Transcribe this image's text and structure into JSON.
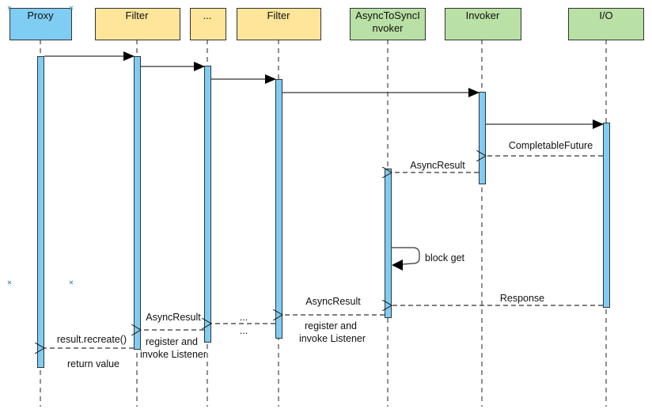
{
  "diagram": {
    "type": "sequence",
    "colors": {
      "proxy_fill": "#7fcdf3",
      "filter_fill": "#ffe599",
      "invoker_fill": "#b9e0a5",
      "activation_fill": "#7fcdf3",
      "stroke": "#333333",
      "lifeline": "#555555",
      "handle": "#4a90c8"
    },
    "participants": [
      {
        "id": "proxy",
        "label": "Proxy",
        "style": "proxy"
      },
      {
        "id": "filter1",
        "label": "Filter",
        "style": "filter"
      },
      {
        "id": "dots",
        "label": "...",
        "style": "filter"
      },
      {
        "id": "filter2",
        "label": "Filter",
        "style": "filter"
      },
      {
        "id": "async",
        "label_lines": [
          "AsyncToSyncI",
          "nvoker"
        ],
        "style": "invoker"
      },
      {
        "id": "invoker",
        "label": "Invoker",
        "style": "invoker"
      },
      {
        "id": "io",
        "label": "I/O",
        "style": "invoker"
      }
    ],
    "messages": [
      {
        "from": "proxy",
        "to": "filter1",
        "kind": "sync",
        "label": ""
      },
      {
        "from": "filter1",
        "to": "dots",
        "kind": "sync",
        "label": ""
      },
      {
        "from": "dots",
        "to": "filter2",
        "kind": "sync",
        "label": ""
      },
      {
        "from": "filter2",
        "to": "invoker",
        "kind": "sync",
        "label": ""
      },
      {
        "from": "invoker",
        "to": "io",
        "kind": "sync",
        "label": ""
      },
      {
        "from": "io",
        "to": "invoker",
        "kind": "return",
        "label": "CompletableFuture"
      },
      {
        "from": "invoker",
        "to": "async",
        "kind": "return",
        "label": "AsyncResult"
      },
      {
        "from": "async",
        "to": "async",
        "kind": "self",
        "label": "block get"
      },
      {
        "from": "io",
        "to": "async",
        "kind": "return",
        "label": "Response"
      },
      {
        "from": "async",
        "to": "filter2",
        "kind": "return",
        "label": "AsyncResult",
        "note_lines": [
          "register and",
          "invoke Listener"
        ]
      },
      {
        "from": "filter2",
        "to": "dots",
        "kind": "return",
        "label": "...",
        "note": "..."
      },
      {
        "from": "dots",
        "to": "filter1",
        "kind": "return",
        "label": "AsyncResult",
        "note_lines": [
          "register and",
          "invoke Listener"
        ]
      },
      {
        "from": "filter1",
        "to": "proxy",
        "kind": "return",
        "label": "result.recreate()",
        "note": "return value"
      }
    ]
  }
}
